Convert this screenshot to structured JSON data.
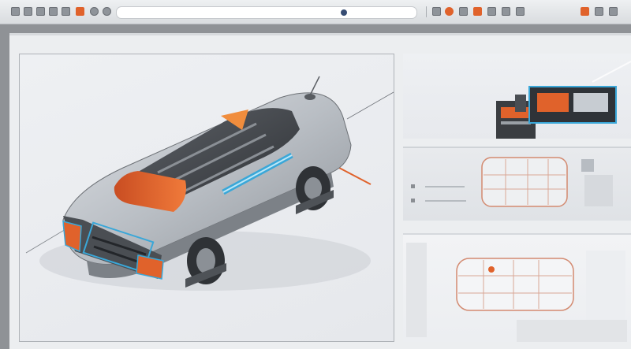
{
  "toolbar": {
    "icons": [
      "back-icon",
      "forward-icon",
      "home-icon",
      "bookmark-icon",
      "tab-icon",
      "history-icon",
      "share-icon",
      "reload-icon",
      "extensions-icon",
      "profile-icon",
      "download-icon",
      "settings-icon",
      "menu-icon"
    ]
  },
  "viewport": {
    "subject_icon": "car-model-icon"
  },
  "right_panel": {
    "panel1": {
      "icon": "rendering-thumbnail-icon"
    },
    "panel2": {
      "label": "",
      "sublabel": ""
    },
    "panel3": {
      "icon": "layout-blueprint-icon"
    }
  },
  "colors": {
    "accent_orange": "#e0622b",
    "accent_blue": "#3aa7d8",
    "body_silver": "#b7bcc2",
    "frame_bg": "#eceef0"
  }
}
